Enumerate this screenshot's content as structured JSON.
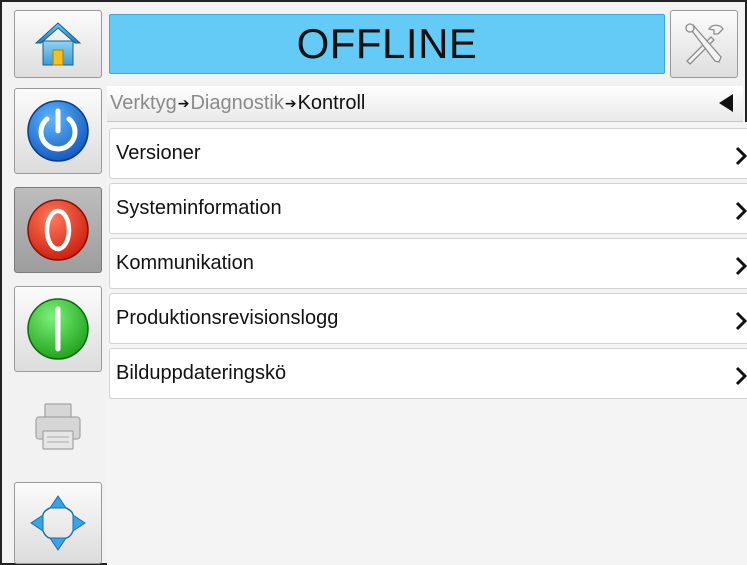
{
  "header": {
    "status": "OFFLINE",
    "home_icon": "home-icon",
    "tools_icon": "tools-icon",
    "status_color": "#63cbf6"
  },
  "sidebar": {
    "power_icon": "power-icon",
    "stop_icon": "stop-icon",
    "start_icon": "start-icon",
    "print_icon": "printer-icon",
    "nav_icon": "navigation-arrows-icon"
  },
  "breadcrumb": {
    "items": [
      "Verktyg",
      "Diagnostik",
      "Kontroll"
    ],
    "separator": "➔"
  },
  "menu": {
    "items": [
      {
        "label": "Versioner"
      },
      {
        "label": "Systeminformation"
      },
      {
        "label": "Kommunikation"
      },
      {
        "label": "Produktionsrevisionslogg"
      },
      {
        "label": "Bilduppdateringskö"
      }
    ]
  }
}
